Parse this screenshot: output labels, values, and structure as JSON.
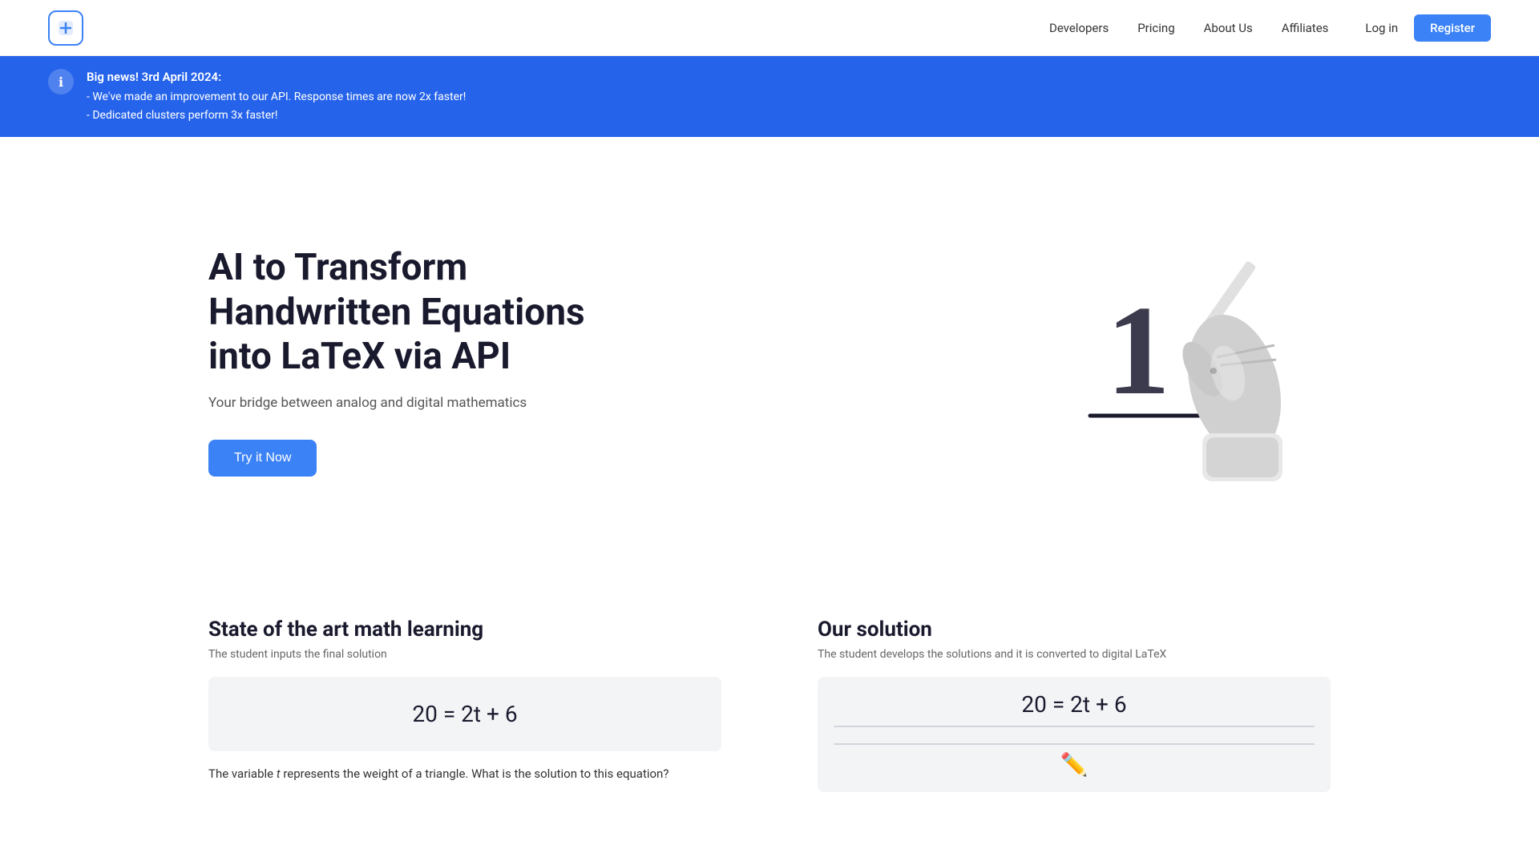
{
  "header": {
    "logo_symbol": "✚",
    "nav": {
      "developers": "Developers",
      "pricing": "Pricing",
      "about_us": "About Us",
      "affiliates": "Affiliates",
      "login": "Log in",
      "register": "Register"
    }
  },
  "banner": {
    "icon": "ℹ",
    "title": "Big news! 3rd April 2024:",
    "line1": "- We've made an improvement to our API. Response times are now 2x faster!",
    "line2": "- Dedicated clusters perform 3x faster!"
  },
  "hero": {
    "title": "AI to Transform Handwritten Equations into LaTeX via API",
    "subtitle": "Your bridge between analog and digital mathematics",
    "cta": "Try it Now"
  },
  "section_left": {
    "title": "State of the art math learning",
    "desc": "The student inputs the final solution",
    "equation": "20 = 2t + 6",
    "body_text": "The variable t represents the weight of a triangle. What is the solution to this equation?"
  },
  "section_right": {
    "title": "Our solution",
    "desc": "The student develops the solutions and it is converted to digital LaTeX",
    "equation": "20 = 2t + 6"
  },
  "colors": {
    "accent": "#3b82f6",
    "banner_bg": "#2563eb",
    "text_dark": "#1a1a2e",
    "text_muted": "#555",
    "bg_light": "#f3f4f6"
  }
}
